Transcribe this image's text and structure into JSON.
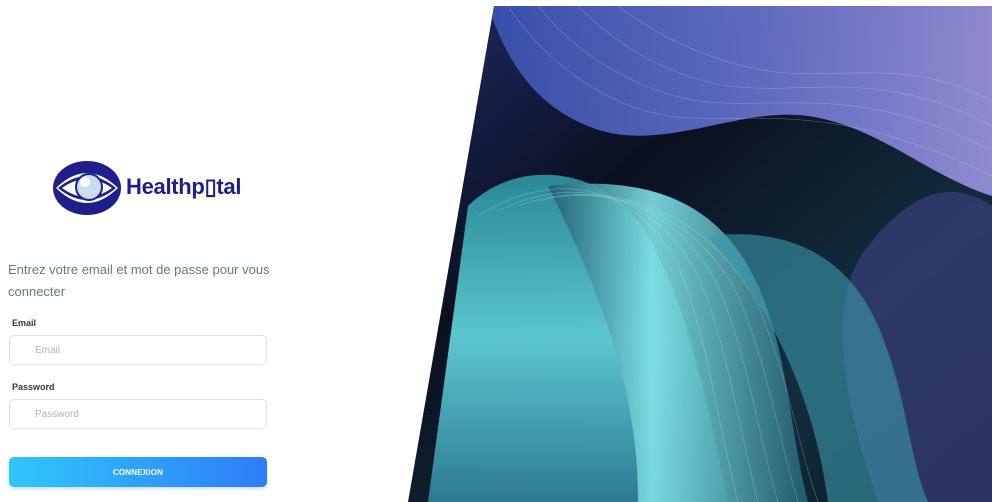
{
  "brand": {
    "name": "Healthpital",
    "display": "Healthp▯tal",
    "color": "#1e1f8a"
  },
  "login": {
    "intro": "Entrez votre email et mot de passe pour vous connecter",
    "email_label": "Email",
    "email_placeholder": "Email",
    "email_value": "",
    "password_label": "Password",
    "password_placeholder": "Password",
    "password_value": "",
    "submit_label": "CONNEXION"
  },
  "colors": {
    "accent_start": "#2fc7fb",
    "accent_end": "#2e7cf7"
  },
  "hero": {
    "image": "abstract-flowing-lines"
  }
}
